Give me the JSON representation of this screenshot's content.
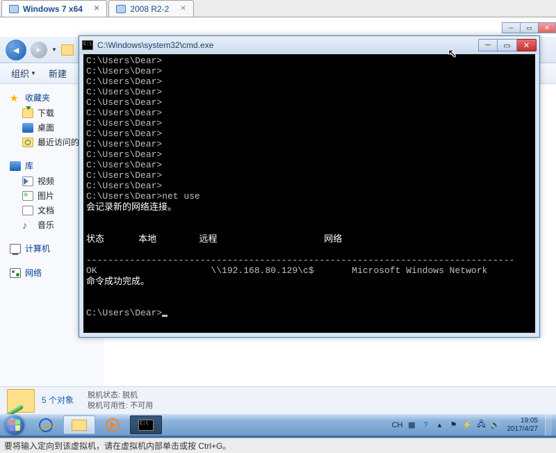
{
  "vm_tabs": [
    {
      "label": "Windows 7 x64",
      "active": true
    },
    {
      "label": "2008 R2-2",
      "active": false
    }
  ],
  "explorer": {
    "toolbar": {
      "organize": "组织",
      "new": "新建"
    },
    "sidebar": {
      "favorites": {
        "head": "收藏夹",
        "items": [
          "下载",
          "桌面",
          "最近访问的"
        ]
      },
      "libraries": {
        "head": "库",
        "items": [
          "视频",
          "图片",
          "文档",
          "音乐"
        ]
      },
      "computer": "计算机",
      "network": "网络"
    },
    "status": {
      "count": "5 个对象",
      "offline_label": "脱机状态:",
      "offline_value": "脱机",
      "avail_label": "脱机可用性:",
      "avail_value": "不可用"
    }
  },
  "cmd": {
    "title": "C:\\Windows\\system32\\cmd.exe",
    "prompt": "C:\\Users\\Dear>",
    "command": "net use",
    "msg_record": "会记录新的网络连接。",
    "hdr_status": "状态",
    "hdr_local": "本地",
    "hdr_remote": "远程",
    "hdr_network": "网络",
    "row_status": "OK",
    "row_remote": "\\\\192.168.80.129\\c$",
    "row_network": "Microsoft Windows Network",
    "msg_done": "命令成功完成。",
    "separator": "-------------------------------------------------------------------------------"
  },
  "tray": {
    "ime": "CH",
    "time": "19:05",
    "date": "2017/4/27"
  },
  "hint": "要将输入定向到该虚拟机，请在虚拟机内部单击或按 Ctrl+G。"
}
